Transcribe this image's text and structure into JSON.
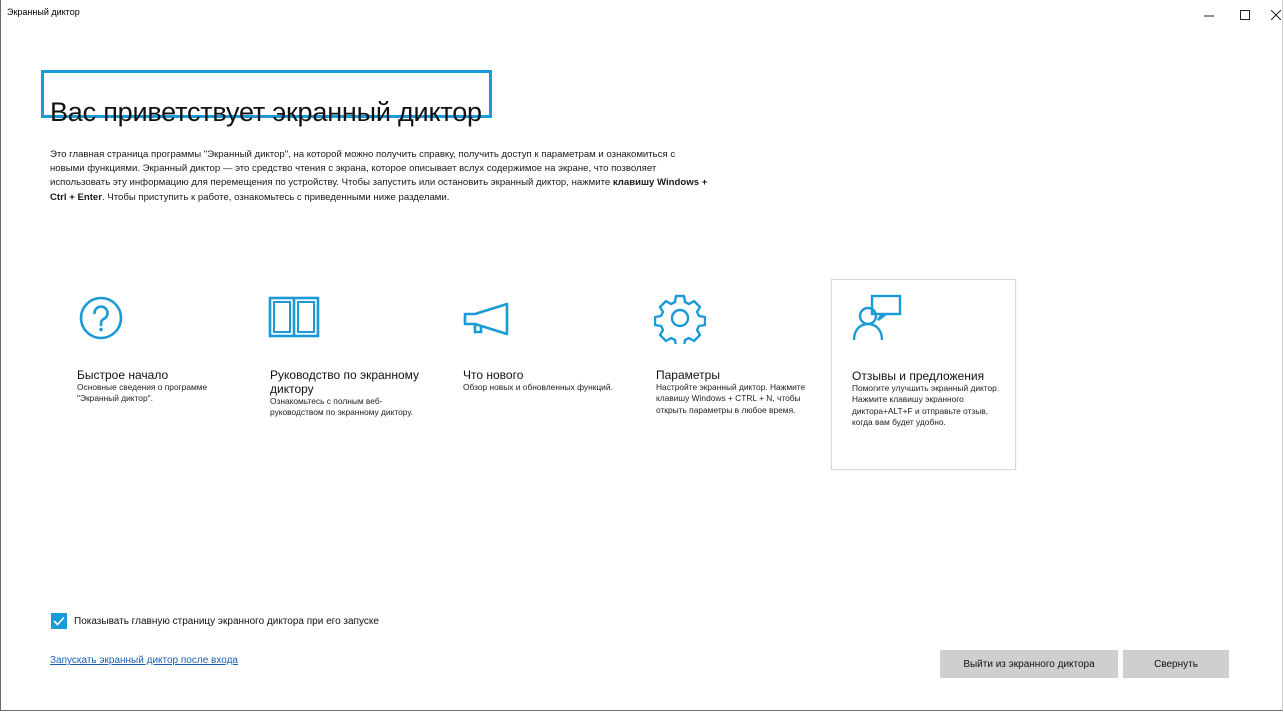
{
  "window": {
    "title": "Экранный диктор",
    "controls": {
      "minimize": "–",
      "maximize": "☐",
      "close": "✕"
    }
  },
  "heading": "Вас приветствует экранный диктор",
  "intro": {
    "text": "Это главная страница программы \"Экранный диктор\", на которой можно получить справку, получить доступ к параметрам и ознакомиться с новыми функциями. Экранный диктор — это средство чтения с экрана, которое описывает вслух содержимое на экране, что позволяет использовать эту информацию для перемещения по устройству. Чтобы запустить или остановить экранный диктор, нажмите ",
    "shortcut": "клавишу Windows + Ctrl + Enter",
    "after": ". Чтобы приступить к работе, ознакомьтесь с приведенными ниже разделами."
  },
  "tiles": [
    {
      "icon": "question-icon",
      "title": "Быстрое начало",
      "description": "Основные сведения о программе \"Экранный диктор\"."
    },
    {
      "icon": "book-icon",
      "title": "Руководство по экранному диктору",
      "description": "Ознакомьтесь с полным веб-руководством по экранному диктору."
    },
    {
      "icon": "megaphone-icon",
      "title": "Что нового",
      "description": "Обзор новых и обновленных функций."
    },
    {
      "icon": "gear-icon",
      "title": "Параметры",
      "description": "Настройте экранный диктор. Нажмите клавишу Windows + CTRL + N, чтобы открыть параметры в любое время."
    },
    {
      "icon": "feedback-icon",
      "title": "Отзывы и предложения",
      "description": "Помогите улучшить экранный диктор. Нажмите клавишу экранного диктора+ALT+F и отправьте отзыв, когда вам будет удобно.",
      "selected": true
    }
  ],
  "show_on_start": {
    "label": "Показывать главную страницу экранного диктора при его запуске",
    "checked": true
  },
  "start_after_signin_link": "Запускать экранный диктор после входа",
  "buttons": {
    "exit": "Выйти из экранного диктора",
    "minimize": "Свернуть"
  },
  "colors": {
    "accent": "#1b9ad8",
    "button_bg": "#cfcfcf",
    "link": "#1a5fb4"
  }
}
